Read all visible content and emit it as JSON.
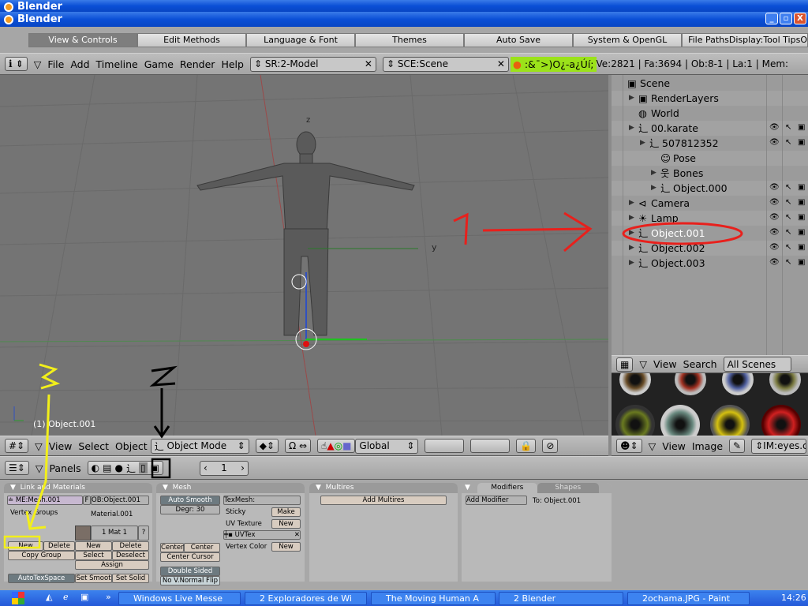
{
  "window": {
    "title_back": "Blender",
    "title": "Blender",
    "min": "_",
    "max": "▫",
    "close": "X"
  },
  "prefs_tabs": [
    "View & Controls",
    "Edit Methods",
    "Language & Font",
    "Themes",
    "Auto Save",
    "System & OpenGL",
    "File PathsDisplay:Tool TipsO"
  ],
  "main_header": {
    "menus": [
      "File",
      "Add",
      "Timeline",
      "Game",
      "Render",
      "Help"
    ],
    "screen": "SR:2-Model",
    "scene": "SCE:Scene",
    "garbled": ":&¯>)O¿-a¿Úí;",
    "stats": "Ve:2821 | Fa:3694 | Ob:8-1 | La:1  | Mem:"
  },
  "viewport": {
    "axis_z": "z",
    "axis_y": "y",
    "object_label": "(1) Object.001"
  },
  "view3d_header": {
    "menus": [
      "View",
      "Select",
      "Object"
    ],
    "mode": "Object Mode",
    "orientation": "Global"
  },
  "outliner": {
    "items": [
      {
        "label": "Scene",
        "indent": 0,
        "icon": "scene-icon"
      },
      {
        "label": "RenderLayers",
        "indent": 1,
        "icon": "renderlayers-icon"
      },
      {
        "label": "World",
        "indent": 1,
        "icon": "world-icon"
      },
      {
        "label": "00.karate",
        "indent": 1,
        "icon": "armature-icon"
      },
      {
        "label": "507812352",
        "indent": 2,
        "icon": "armature-icon"
      },
      {
        "label": "Pose",
        "indent": 3,
        "icon": "pose-icon"
      },
      {
        "label": "Bones",
        "indent": 3,
        "icon": "bones-icon"
      },
      {
        "label": "Object.000",
        "indent": 3,
        "icon": "armature-icon"
      },
      {
        "label": "Camera",
        "indent": 1,
        "icon": "camera-icon"
      },
      {
        "label": "Lamp",
        "indent": 1,
        "icon": "lamp-icon"
      },
      {
        "label": "Object.001",
        "indent": 1,
        "icon": "armature-icon",
        "selected": true
      },
      {
        "label": "Object.002",
        "indent": 1,
        "icon": "armature-icon"
      },
      {
        "label": "Object.003",
        "indent": 1,
        "icon": "armature-icon"
      }
    ]
  },
  "outliner_header": {
    "menus": [
      "View",
      "Search"
    ],
    "filter": "All Scenes"
  },
  "image_header": {
    "menus": [
      "View",
      "Image"
    ],
    "image": "IM:eyes.c"
  },
  "buttons_header": {
    "panels_label": "Panels",
    "frame": "1"
  },
  "link_materials": {
    "title": "Link and Materials",
    "mesh": "ME:Mesh.001",
    "f": "F",
    "object": "OB:Object.001",
    "vertex_groups": "Vertex Groups",
    "material": "Material.001",
    "mat_index": "1 Mat 1",
    "question": "?",
    "new": "New",
    "delete": "Delete",
    "copy_group": "Copy Group",
    "mat_new": "New",
    "mat_delete": "Delete",
    "select": "Select",
    "deselect": "Deselect",
    "assign": "Assign",
    "autotex": "AutoTexSpace",
    "set_smooth": "Set Smoot",
    "set_solid": "Set Solid"
  },
  "mesh_panel": {
    "title": "Mesh",
    "auto_smooth": "Auto Smooth",
    "degr": "Degr: 30",
    "texmesh": "TexMesh:",
    "sticky": "Sticky",
    "make": "Make",
    "uv_texture": "UV Texture",
    "uv_new": "New",
    "uvtex": "UVTex",
    "vertex_color": "Vertex Color",
    "vc_new": "New",
    "center": "Center",
    "center_new": "Center New",
    "center_cursor": "Center Cursor",
    "double_sided": "Double Sided",
    "no_vnormal": "No V.Normal Flip"
  },
  "multires": {
    "title": "Multires",
    "add": "Add Multires"
  },
  "modifiers": {
    "tab1": "Modifiers",
    "tab2": "Shapes",
    "add": "Add Modifier",
    "to": "To: Object.001"
  },
  "annotations": {
    "one": "1",
    "two": "2",
    "three": "3",
    "colors": {
      "one": "#e8201c",
      "two": "#000000",
      "three": "#f2ef1a"
    }
  },
  "taskbar": {
    "tasks": [
      "Windows Live Messe",
      "2 Exploradores de Wi",
      "The Moving Human A",
      "2 Blender",
      "2ochama.JPG - Paint"
    ],
    "clock": "14:26"
  }
}
